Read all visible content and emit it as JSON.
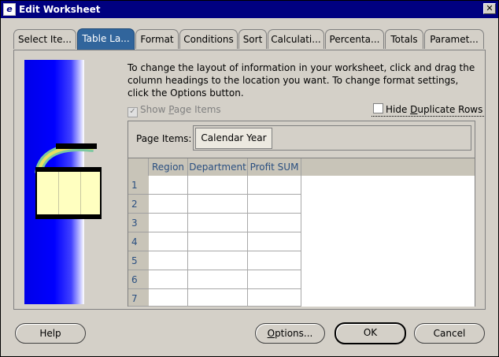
{
  "window": {
    "title": "Edit Worksheet",
    "close_label": "✕"
  },
  "tabs": [
    {
      "label": "Select Ite..."
    },
    {
      "label": "Table La..."
    },
    {
      "label": "Format"
    },
    {
      "label": "Conditions"
    },
    {
      "label": "Sort"
    },
    {
      "label": "Calculati..."
    },
    {
      "label": "Percenta..."
    },
    {
      "label": "Totals"
    },
    {
      "label": "Paramet..."
    }
  ],
  "active_tab": "Table La...",
  "description": "To change the layout of information in your worksheet, click and drag the column headings to the location you want.  To change format settings, click the Options button.",
  "show_page_items": {
    "label_before": "Show ",
    "label_underlined": "P",
    "label_after": "age Items",
    "checked": true,
    "enabled": false
  },
  "hide_duplicate_rows": {
    "label_before": "Hide ",
    "label_underlined": "D",
    "label_after": "uplicate Rows",
    "checked": false
  },
  "page_items": {
    "label": "Page Items:",
    "items": [
      "Calendar Year"
    ]
  },
  "grid": {
    "columns": [
      "Region",
      "Department",
      "Profit SUM"
    ],
    "rows": [
      "1",
      "2",
      "3",
      "4",
      "5",
      "6",
      "7"
    ]
  },
  "buttons": {
    "help": "Help",
    "options_underlined": "O",
    "options_rest": "ptions...",
    "ok": "OK",
    "cancel": "Cancel"
  },
  "colors": {
    "title_bar": "#000080",
    "active_tab": "#31659c",
    "header_text": "#2a4f80",
    "illustration_blue": "#0000ff"
  }
}
